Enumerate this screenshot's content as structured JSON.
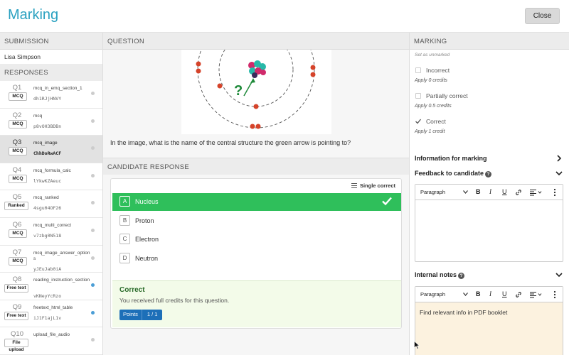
{
  "header": {
    "title": "Marking",
    "close_label": "Close"
  },
  "columns": {
    "submission": "SUBMISSION",
    "question": "QUESTION",
    "marking": "MARKING",
    "candidate_response": "CANDIDATE RESPONSE"
  },
  "submission": {
    "student_name": "Lisa Simpson"
  },
  "responses": {
    "header": "RESPONSES",
    "items": [
      {
        "num": "Q1",
        "type": "MCQ",
        "name": "mcq_in_emq_section_1",
        "code": "dh1RJjHNVY",
        "status": "grey"
      },
      {
        "num": "Q2",
        "type": "MCQ",
        "name": "mcq",
        "code": "p8vOH3BDBn",
        "status": "grey"
      },
      {
        "num": "Q3",
        "type": "MCQ",
        "name": "mcq_image",
        "code": "ChhDoRwACF",
        "status": "grey",
        "active": true
      },
      {
        "num": "Q4",
        "type": "MCQ",
        "name": "mcq_formula_calc",
        "code": "lYkwKZAeuc",
        "status": "grey"
      },
      {
        "num": "Q5",
        "type": "Ranked",
        "name": "mcq_ranked",
        "code": "4sgu04OF26",
        "status": "grey"
      },
      {
        "num": "Q6",
        "type": "MCQ",
        "name": "mcq_multi_correct",
        "code": "v7zbg0N518",
        "status": "grey"
      },
      {
        "num": "Q7",
        "type": "MCQ",
        "name": "mcq_image_answer_options",
        "code": "yJEuJab0iA",
        "status": "grey"
      },
      {
        "num": "Q8",
        "type": "Free text",
        "name": "reading_instruction_section",
        "code": "vKNeyYcRzo",
        "status": "blue"
      },
      {
        "num": "Q9",
        "type": "Free text",
        "name": "freetext_html_table",
        "code": "iJ1F1ajL1v",
        "status": "blue"
      },
      {
        "num": "Q10",
        "type": "File upload",
        "name": "upload_file_audio",
        "code": "",
        "status": "grey"
      }
    ]
  },
  "question": {
    "text": "In the image, what is the name of the central structure the green arrow is pointing to?",
    "image_label": "?"
  },
  "candidate": {
    "mode_label": "Single correct",
    "options": [
      {
        "letter": "A",
        "text": "Nucleus",
        "selected": true
      },
      {
        "letter": "B",
        "text": "Proton"
      },
      {
        "letter": "C",
        "text": "Electron"
      },
      {
        "letter": "D",
        "text": "Neutron"
      }
    ],
    "result": {
      "title": "Correct",
      "message": "You received full credits for this question.",
      "points_label": "Points",
      "points_value": "1 / 1"
    }
  },
  "marking": {
    "set_unmarked": "Set as unmarked",
    "options": [
      {
        "label": "Incorrect",
        "credits": "Apply 0 credits",
        "checked": false
      },
      {
        "label": "Partially correct",
        "credits": "Apply 0.5 credits",
        "checked": false
      },
      {
        "label": "Correct",
        "credits": "Apply 1 credit",
        "checked": true
      }
    ],
    "info_title": "Information for marking",
    "feedback_title": "Feedback to candidate",
    "notes_title": "Internal notes",
    "paragraph_label": "Paragraph",
    "toolbar": {
      "bold": "B",
      "italic": "I",
      "underline": "U"
    },
    "feedback_body": "",
    "notes_body": "Find relevant info in PDF booklet"
  },
  "colors": {
    "accent": "#2aa1c0",
    "correct_green": "#2fbf5b",
    "points_blue": "#1d6fb8",
    "notes_bg": "#fcf2df"
  }
}
